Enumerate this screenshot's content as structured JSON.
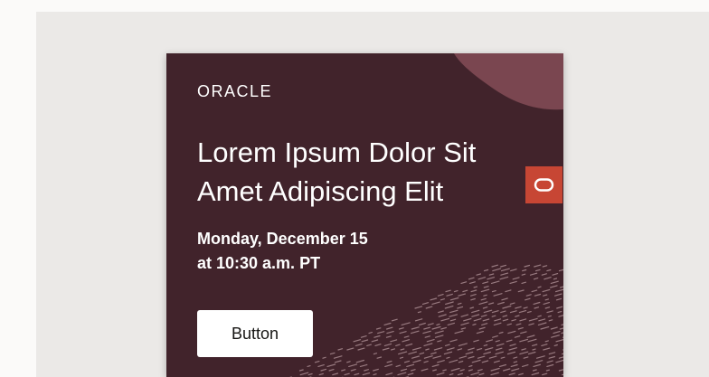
{
  "brand": {
    "logo_text": "ORACLE"
  },
  "event": {
    "headline_line1": "Lorem Ipsum Dolor Sit",
    "headline_line2": "Amet Adipiscing Elit",
    "date_line1": "Monday, December 15",
    "date_line2": "at 10:30 a.m. PT"
  },
  "cta": {
    "label": "Button"
  },
  "side_tab": {
    "icon": "oracle-o-icon"
  },
  "colors": {
    "card_background": "#41232b",
    "accent_blob": "#7a4650",
    "side_tab": "#c74634",
    "button_background": "#ffffff",
    "page_background": "#ebe9e7"
  }
}
